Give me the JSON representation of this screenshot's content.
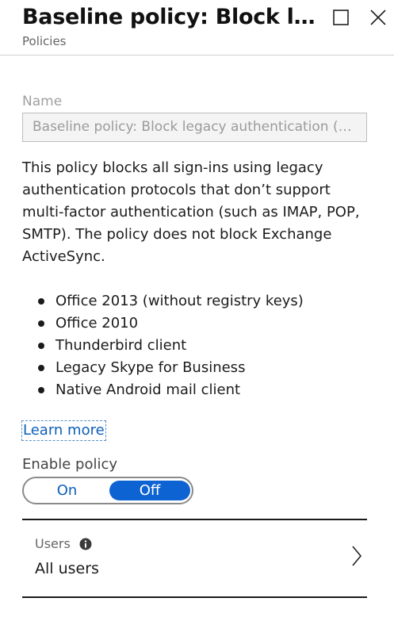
{
  "header": {
    "title": "Baseline policy: Block legacy authentication (Preview)",
    "subtitle": "Policies",
    "maximize_icon": "square-icon",
    "close_icon": "close-x-icon"
  },
  "name_field": {
    "label": "Name",
    "value": "Baseline policy: Block legacy authentication (Preview)"
  },
  "description": "This policy blocks all sign-ins using legacy authentication protocols that don’t support multi-factor authentication (such as IMAP, POP, SMTP). The policy does not block Exchange ActiveSync.",
  "clients": [
    "Office 2013 (without registry keys)",
    "Office 2010",
    "Thunderbird client",
    "Legacy Skype for Business",
    "Native Android mail client"
  ],
  "learn_more": "Learn more",
  "enable_policy": {
    "label": "Enable policy",
    "on_label": "On",
    "off_label": "Off",
    "selected": "Off"
  },
  "users": {
    "label": "Users",
    "value": "All users",
    "info_icon": "info-icon",
    "chevron_icon": "chevron-right-icon"
  },
  "colors": {
    "accent": "#0e63d3",
    "link": "#0e5fb8",
    "text": "#1b1b1b",
    "muted": "#666666"
  }
}
